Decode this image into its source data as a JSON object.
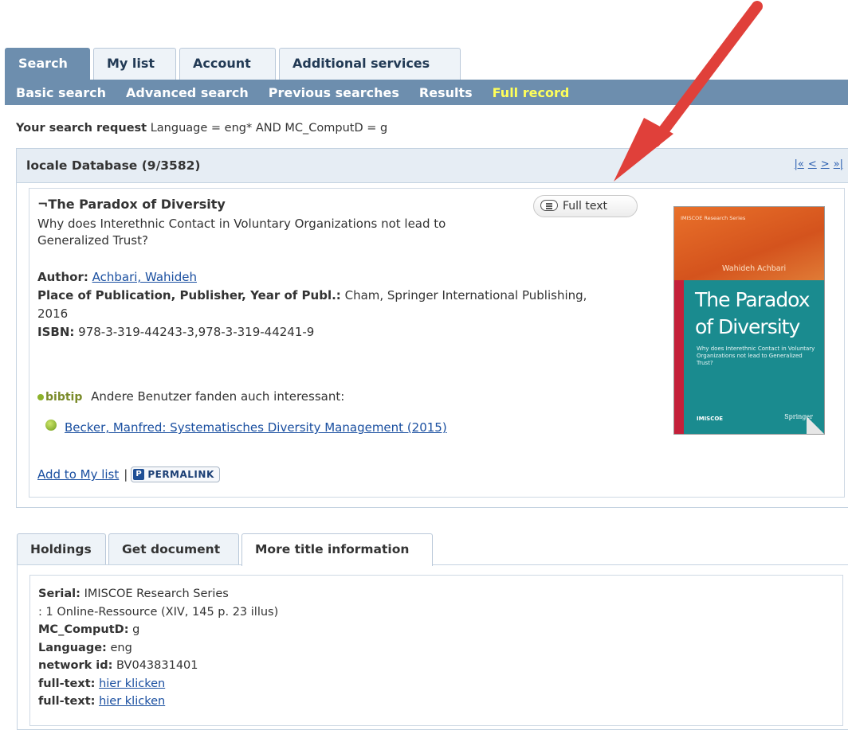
{
  "main_tabs": [
    "Search",
    "My list",
    "Account",
    "Additional services"
  ],
  "sub_nav": [
    "Basic search",
    "Advanced search",
    "Previous searches",
    "Results",
    "Full record"
  ],
  "search_request": {
    "label": "Your search request",
    "query": "Language = eng* AND MC_ComputD = g"
  },
  "record_panel": {
    "db_title": "locale Database (9/3582)",
    "pager": [
      "|«",
      "<",
      ">",
      "»|"
    ]
  },
  "record": {
    "title": "¬The Paradox of Diversity",
    "subtitle": "Why does Interethnic Contact in Voluntary Organizations not lead to Generalized Trust?",
    "fulltext_button": "Full text",
    "author_label": "Author:",
    "author_value": "Achbari, Wahideh",
    "publication_label": "Place of Publication, Publisher, Year of Publ.:",
    "publication_value": "Cham, Springer International Publishing, 2016",
    "isbn_label": "ISBN:",
    "isbn_value": "978-3-319-44243-3,978-3-319-44241-9",
    "bibtip_logo": "bibtip",
    "bibtip_text": "Andere Benutzer fanden auch interessant:",
    "related_link": "Becker, Manfred: Systematisches Diversity Management (2015)",
    "add_to_list": "Add to My list",
    "separator": "|",
    "permalink_icon": "P",
    "permalink": "PERMALINK"
  },
  "cover": {
    "series": "IMISCOE Research Series",
    "author": "Wahideh Achbari",
    "title_line1": "The Paradox",
    "title_line2": "of Diversity",
    "subtitle": "Why does Interethnic Contact in Voluntary Organizations not lead to Generalized Trust?",
    "imiscoe": "IMISCOE",
    "publisher": "Springer",
    "colors": {
      "top": "#e06a28",
      "teal": "#1a8b8f",
      "red_bar": "#c4203a"
    }
  },
  "annotation": {
    "arrow_color": "#e0403a"
  },
  "lower_tabs": [
    "Holdings",
    "Get document",
    "More title information"
  ],
  "more_info": [
    {
      "label": "Serial:",
      "value": "IMISCOE Research Series"
    },
    {
      "label": "",
      "value": ": 1 Online-Ressource (XIV, 145 p. 23 illus)"
    },
    {
      "label": "MC_ComputD:",
      "value": "g"
    },
    {
      "label": "Language:",
      "value": "eng"
    },
    {
      "label": "network id:",
      "value": "BV043831401"
    },
    {
      "label": "full-text:",
      "link": "hier klicken"
    },
    {
      "label": "full-text:",
      "link": "hier klicken"
    }
  ],
  "colors": {
    "nav_blue": "#6d8eae",
    "active_sub": "#ffff5a",
    "link": "#1a4fa0"
  }
}
